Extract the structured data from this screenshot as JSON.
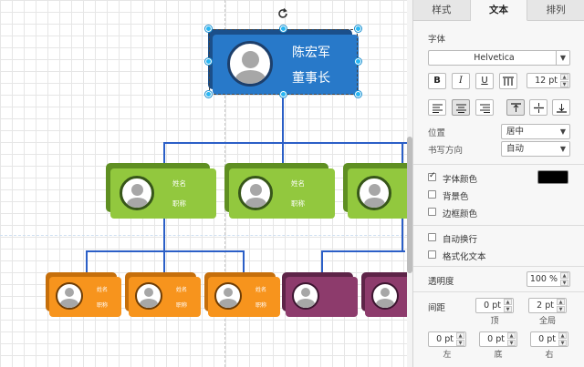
{
  "colors": {
    "ceo_front": "#2879c9",
    "ceo_back": "#1b4f8a",
    "manager_front": "#92c83e",
    "manager_back": "#5f8f22",
    "orange_front": "#f7941d",
    "orange_back": "#c66f0b",
    "purple_front": "#8d3b6c",
    "purple_back": "#5e2448",
    "connector": "#2b5fc7"
  },
  "chart": {
    "ceo": {
      "name": "陈宏军",
      "title": "董事长"
    },
    "managers": [
      {
        "name": "姓名",
        "title": "职称"
      },
      {
        "name": "姓名",
        "title": "职称"
      }
    ],
    "staff": [
      {
        "name": "姓名",
        "title": "职称"
      },
      {
        "name": "姓名",
        "title": "职称"
      },
      {
        "name": "姓名",
        "title": "职称"
      }
    ]
  },
  "panel": {
    "tabs": [
      "样式",
      "文本",
      "排列"
    ],
    "active_tab": "文本",
    "font_section": "字体",
    "font_family": "Helvetica",
    "font_size": "12 pt",
    "bold_label": "B",
    "italic_label": "I",
    "underline_label": "U",
    "position_label": "位置",
    "position_value": "居中",
    "direction_label": "书写方向",
    "direction_value": "自动",
    "font_color_label": "字体颜色",
    "font_color_value": "#000000",
    "background_label": "背景色",
    "border_color_label": "边框颜色",
    "wrap_label": "自动换行",
    "formatted_label": "格式化文本",
    "opacity_label": "透明度",
    "opacity_value": "100 %",
    "spacing_label": "间距",
    "spacing_top": "0 pt",
    "spacing_top_label": "顶",
    "spacing_global": "2 pt",
    "spacing_global_label": "全局",
    "spacing_left": "0 pt",
    "spacing_left_label": "左",
    "spacing_bottom": "0 pt",
    "spacing_bottom_label": "底",
    "spacing_right": "0 pt",
    "spacing_right_label": "右"
  }
}
